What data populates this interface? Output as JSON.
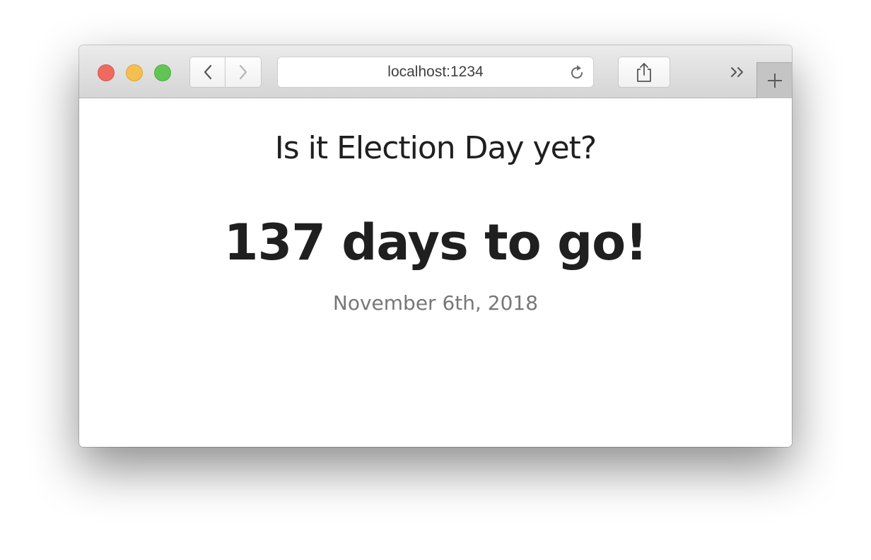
{
  "browser": {
    "url": "localhost:1234",
    "icons": {
      "back": "chevron-left-icon",
      "forward": "chevron-right-icon",
      "reload": "reload-icon",
      "share": "share-icon",
      "overflow": "double-chevron-right-icon",
      "new_tab": "plus-icon"
    },
    "traffic_lights": {
      "close": "#ee6a5f",
      "minimize": "#f5bf4f",
      "maximize": "#61c554"
    }
  },
  "page": {
    "question": "Is it Election Day yet?",
    "countdown": "137 days to go!",
    "date": "November 6th, 2018"
  }
}
